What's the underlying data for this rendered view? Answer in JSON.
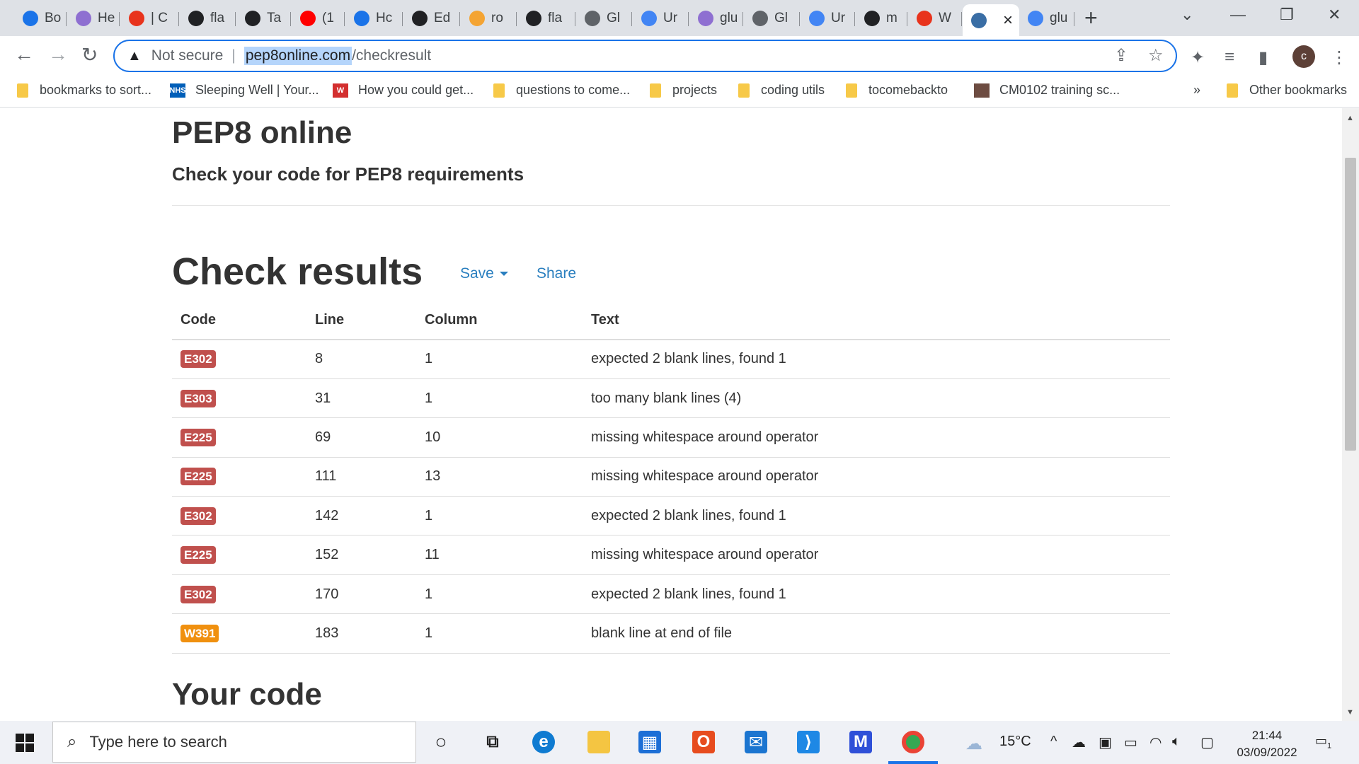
{
  "browser": {
    "tabs": [
      {
        "label": "Bo",
        "favicon": "star-icon",
        "color": "#1a73e8"
      },
      {
        "label": "He",
        "favicon": "h-icon",
        "color": "#8e6fd1"
      },
      {
        "label": "| C",
        "favicon": "opera-icon",
        "color": "#e8331c"
      },
      {
        "label": "fla",
        "favicon": "github-icon",
        "color": "#202124"
      },
      {
        "label": "Ta",
        "favicon": "github-icon",
        "color": "#202124"
      },
      {
        "label": "(1",
        "favicon": "youtube-icon",
        "color": "#ff0000"
      },
      {
        "label": "Hc",
        "favicon": "swirl-icon",
        "color": "#1a73e8"
      },
      {
        "label": "Ed",
        "favicon": "github-icon",
        "color": "#202124"
      },
      {
        "label": "ro",
        "favicon": "g-icon",
        "color": "#f4a433"
      },
      {
        "label": "fla",
        "favicon": "github-icon",
        "color": "#202124"
      },
      {
        "label": "Gl",
        "favicon": "globe-icon",
        "color": "#5f6368"
      },
      {
        "label": "Ur",
        "favicon": "docs-icon",
        "color": "#4285f4"
      },
      {
        "label": "glu",
        "favicon": "h-icon",
        "color": "#8e6fd1"
      },
      {
        "label": "Gl",
        "favicon": "globe-icon",
        "color": "#5f6368"
      },
      {
        "label": "Ur",
        "favicon": "docs-icon",
        "color": "#4285f4"
      },
      {
        "label": "m",
        "favicon": "github-icon",
        "color": "#202124"
      },
      {
        "label": "W",
        "favicon": "opera-icon",
        "color": "#e8331c"
      },
      {
        "label": "",
        "favicon": "pep8-icon",
        "color": "#3a6ea5"
      },
      {
        "label": "glu",
        "favicon": "google-icon",
        "color": "#4285f4"
      }
    ],
    "address": {
      "security_label": "Not secure",
      "host": "pep8online.com",
      "path": "/checkresult"
    },
    "bookmarks": [
      {
        "label": "bookmarks to sort...",
        "icon": "folder-icon"
      },
      {
        "label": "Sleeping Well | Your...",
        "icon": "nhs-icon"
      },
      {
        "label": "How you could get...",
        "icon": "w-icon"
      },
      {
        "label": "questions to come...",
        "icon": "folder-icon"
      },
      {
        "label": "projects",
        "icon": "folder-icon"
      },
      {
        "label": "coding utils",
        "icon": "folder-icon"
      },
      {
        "label": "tocomebackto",
        "icon": "folder-icon"
      },
      {
        "label": "CM0102 training sc...",
        "icon": "image-icon"
      }
    ],
    "overflow_label": "»",
    "other_bookmarks": "Other bookmarks",
    "avatar_letter": "c"
  },
  "page": {
    "site_title": "PEP8 online",
    "subtitle": "Check your code for PEP8 requirements",
    "results_heading": "Check results",
    "save_label": "Save",
    "share_label": "Share",
    "columns": [
      "Code",
      "Line",
      "Column",
      "Text"
    ],
    "rows": [
      {
        "code": "E302",
        "line": "8",
        "column": "1",
        "text": "expected 2 blank lines, found 1",
        "badge_color": "#c0504d"
      },
      {
        "code": "E303",
        "line": "31",
        "column": "1",
        "text": "too many blank lines (4)",
        "badge_color": "#c0504d"
      },
      {
        "code": "E225",
        "line": "69",
        "column": "10",
        "text": "missing whitespace around operator",
        "badge_color": "#c0504d"
      },
      {
        "code": "E225",
        "line": "111",
        "column": "13",
        "text": "missing whitespace around operator",
        "badge_color": "#c0504d"
      },
      {
        "code": "E302",
        "line": "142",
        "column": "1",
        "text": "expected 2 blank lines, found 1",
        "badge_color": "#c0504d"
      },
      {
        "code": "E225",
        "line": "152",
        "column": "11",
        "text": "missing whitespace around operator",
        "badge_color": "#c0504d"
      },
      {
        "code": "E302",
        "line": "170",
        "column": "1",
        "text": "expected 2 blank lines, found 1",
        "badge_color": "#c0504d"
      },
      {
        "code": "W391",
        "line": "183",
        "column": "1",
        "text": "blank line at end of file",
        "badge_color": "#f0900f"
      }
    ],
    "code_heading": "Your code",
    "link_color": "#2a7fbf"
  },
  "taskbar": {
    "search_placeholder": "Type here to search",
    "weather": "15°C",
    "time": "21:44",
    "date": "03/09/2022",
    "notification_count": "1"
  }
}
